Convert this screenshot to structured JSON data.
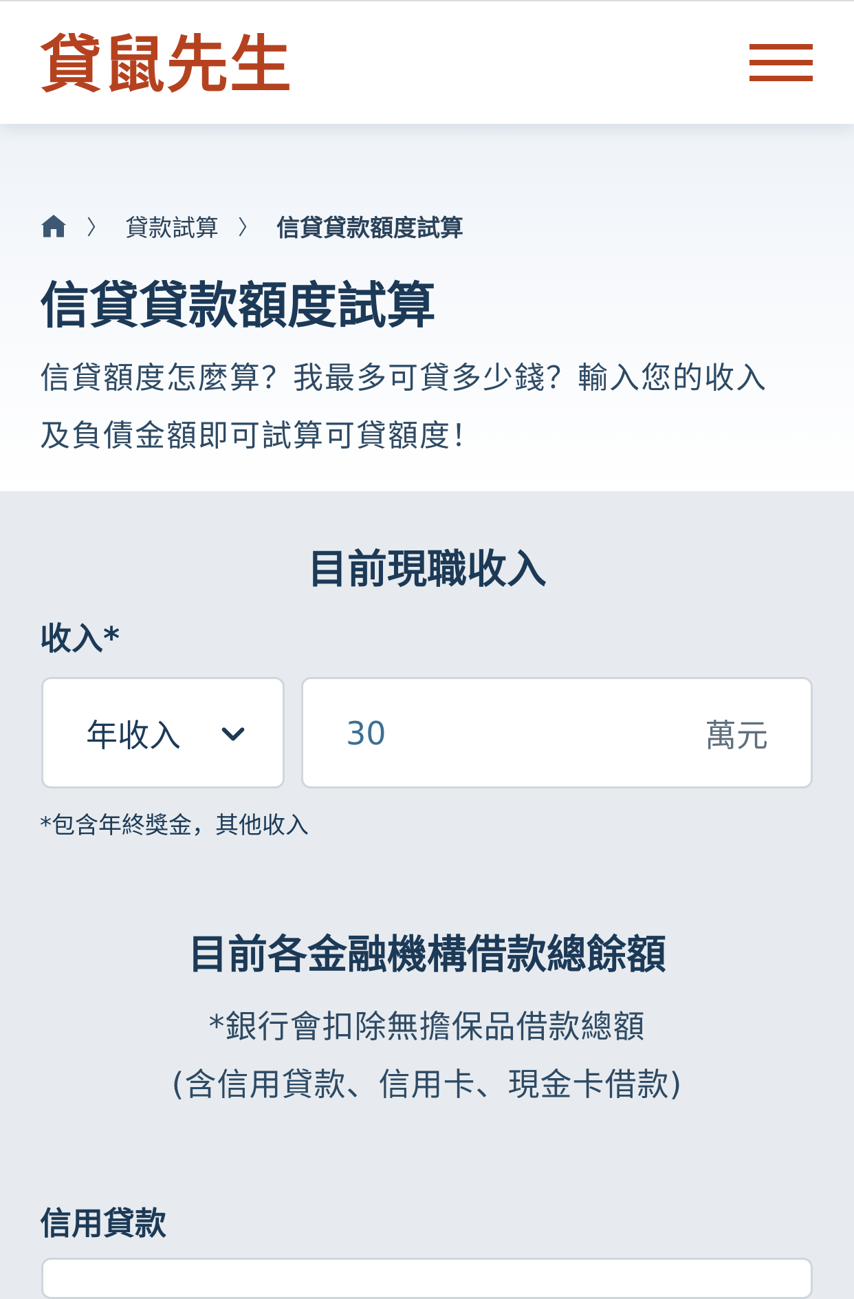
{
  "header": {
    "logo_text": "貸鼠先生",
    "brand_color": "#b5421f",
    "menu_icon": "hamburger-menu-icon"
  },
  "breadcrumb": {
    "home_icon": "home-icon",
    "separator": "〉",
    "items": [
      "貸款試算",
      "信貸貸款額度試算"
    ]
  },
  "hero": {
    "title": "信貸貸款額度試算",
    "description_line1": "信貸額度怎麼算？我最多可貸多少錢？輸入您的收入",
    "description_line2": "及負債金額即可試算可貸額度！"
  },
  "income_section": {
    "title": "目前現職收入",
    "label": "收入*",
    "period_select": "年收入",
    "amount_value": "30",
    "unit": "萬元",
    "note": "*包含年終獎金，其他收入"
  },
  "debt_section": {
    "title": "目前各金融機構借款總餘額",
    "note_line1": "*銀行會扣除無擔保品借款總額",
    "note_line2": "(含信用貸款、信用卡、現金卡借款)",
    "credit_loan_label": "信用貸款"
  }
}
